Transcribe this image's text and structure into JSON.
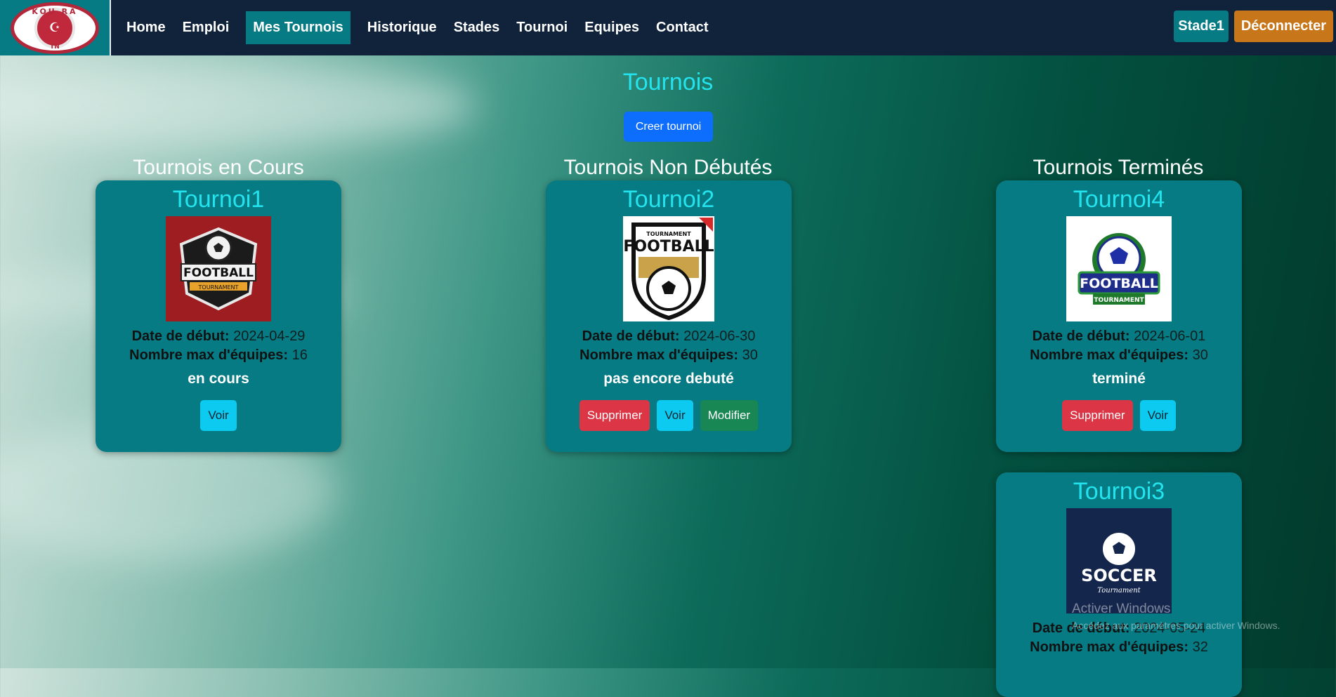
{
  "nav": {
    "logo_brand": "KOU RA",
    "logo_sub": "TN",
    "links": [
      "Home",
      "Emploi",
      "Mes Tournois",
      "Historique",
      "Stades",
      "Tournoi",
      "Equipes",
      "Contact"
    ],
    "stade_label": "Stade1",
    "logout_label": "Déconnecter"
  },
  "page": {
    "title": "Tournois",
    "create_label": "Creer tournoi"
  },
  "columns": {
    "en_cours": "Tournois en Cours",
    "non_debutes": "Tournois Non Débutés",
    "termines": "Tournois Terminés"
  },
  "labels": {
    "date": "Date de début:",
    "max": "Nombre max d'équipes:",
    "voir": "Voir",
    "supprimer": "Supprimer",
    "modifier": "Modifier"
  },
  "cards": [
    {
      "name": "Tournoi1",
      "date": "2024-04-29",
      "max": "16",
      "status": "en cours",
      "logo_text": "FOOTBALL",
      "logo_sub": "TOURNAMENT"
    },
    {
      "name": "Tournoi2",
      "date": "2024-06-30",
      "max": "30",
      "status": "pas encore debuté",
      "logo_text": "FOOTBALL",
      "logo_sub": "TOURNAMENT"
    },
    {
      "name": "Tournoi4",
      "date": "2024-06-01",
      "max": "30",
      "status": "terminé",
      "logo_text": "FOOTBALL",
      "logo_sub": "TOURNAMENT"
    },
    {
      "name": "Tournoi3",
      "date": "2024-05-24",
      "max": "32",
      "status": "",
      "logo_text": "SOCCER",
      "logo_sub": "Tournament"
    }
  ],
  "watermark": {
    "line1": "Activer Windows",
    "line2": "Accédez aux paramètres pour activer Windows."
  }
}
